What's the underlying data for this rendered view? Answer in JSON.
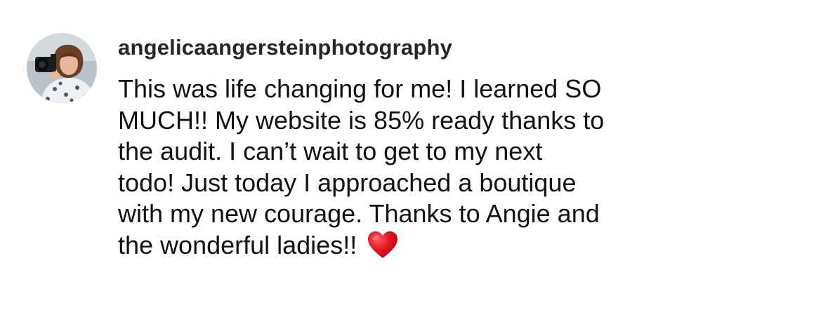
{
  "comment": {
    "username": "angelicaangersteinphotography",
    "text_lines": [
      "This was life changing for me! I learned SO",
      "MUCH!! My website is 85% ready thanks to",
      "the audit. I can’t wait to get to my next",
      "todo! Just today I approached a boutique",
      "with my new courage. Thanks to Angie and",
      "the wonderful ladies!!"
    ],
    "emoji": "heart-emoji"
  },
  "colors": {
    "username": "#262626",
    "text": "#111111",
    "heart": "#e0141e"
  }
}
